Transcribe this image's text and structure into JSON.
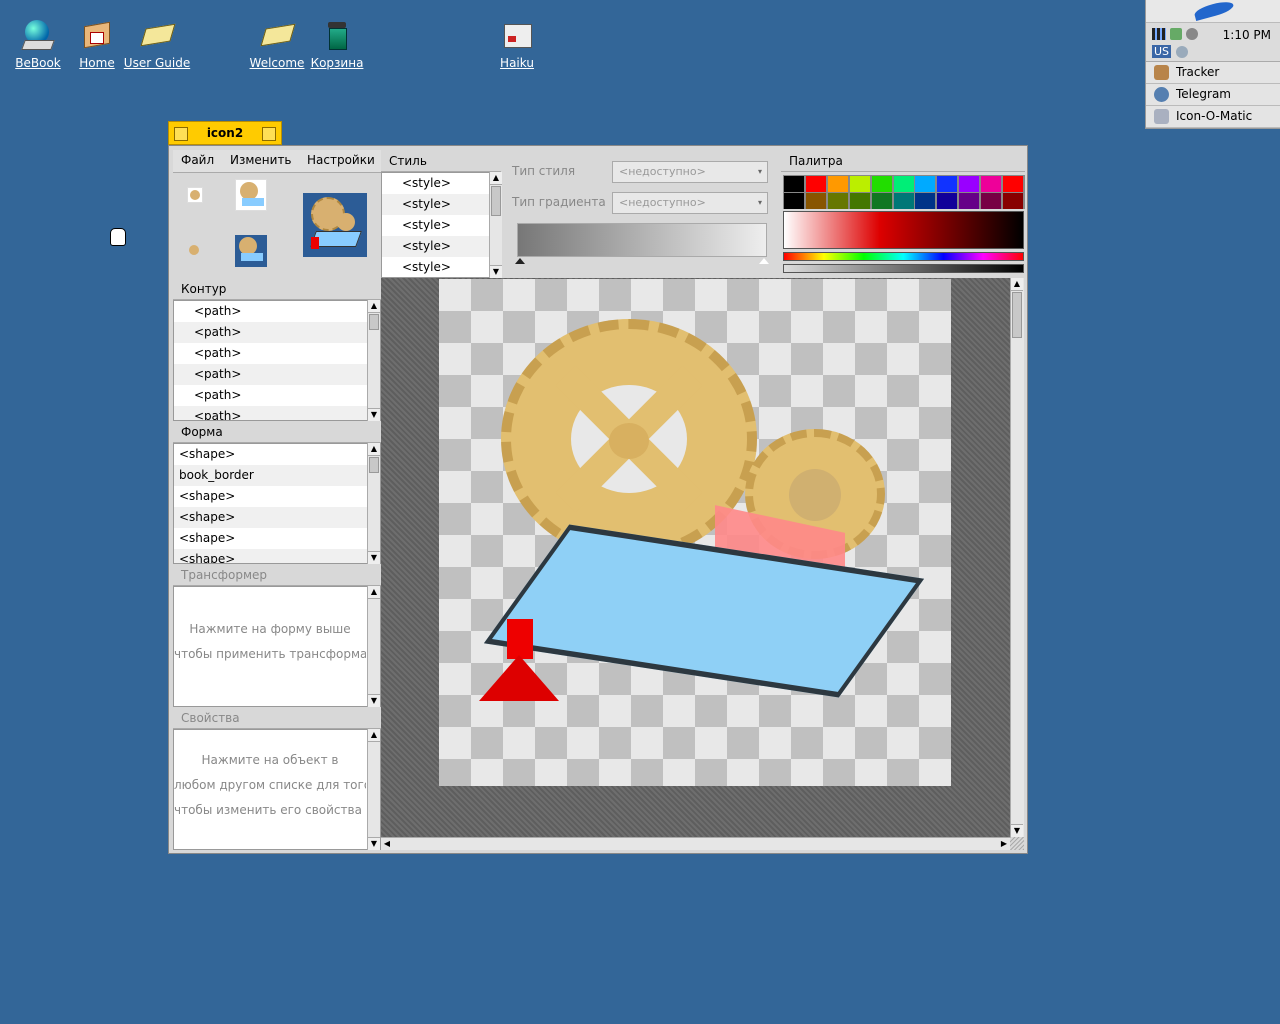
{
  "desktop": {
    "icons": [
      {
        "label": "BeBook",
        "icon": "globe-book-icon"
      },
      {
        "label": "Home",
        "icon": "home-folder-icon"
      },
      {
        "label": "User Guide",
        "icon": "user-guide-icon"
      },
      {
        "label": "Welcome",
        "icon": "welcome-icon"
      },
      {
        "label": "Корзина",
        "icon": "trash-icon"
      },
      {
        "label": "Haiku",
        "icon": "haiku-disk-icon"
      }
    ]
  },
  "deskbar": {
    "time": "1:10 PM",
    "keyboard_layout": "US",
    "apps": [
      {
        "label": "Tracker",
        "icon": "tracker-icon"
      },
      {
        "label": "Telegram",
        "icon": "telegram-icon"
      },
      {
        "label": "Icon-O-Matic",
        "icon": "icon-o-matic-icon"
      }
    ]
  },
  "window": {
    "title": "icon2",
    "menu": {
      "file": "Файл",
      "edit": "Изменить",
      "settings": "Настройки"
    },
    "style_header": "Стиль",
    "styles": [
      "<style>",
      "<style>",
      "<style>",
      "<style>",
      "<style>"
    ],
    "style_type_label": "Тип стиля",
    "style_type_value": "<недоступно>",
    "gradient_type_label": "Тип градиента",
    "gradient_type_value": "<недоступно>",
    "palette_header": "Палитра",
    "path_header": "Контур",
    "paths": [
      "<path>",
      "<path>",
      "<path>",
      "<path>",
      "<path>",
      "<path>"
    ],
    "shape_header": "Форма",
    "shapes": [
      "<shape>",
      "book_border",
      "<shape>",
      "<shape>",
      "<shape>",
      "<shape>"
    ],
    "transformer_header": "Трансформер",
    "transformer_hint": [
      "Нажмите на форму выше",
      "чтобы применить трансформатор"
    ],
    "properties_header": "Свойства",
    "properties_hint": [
      "Нажмите на объект в",
      "любом другом списке для того,",
      "чтобы изменить его свойства здесь"
    ]
  },
  "colors": {
    "desktop": "#336698",
    "tab": "#ffcb00",
    "palette_row1": [
      "#000000",
      "#ff0000",
      "#ff9900",
      "#bbee00",
      "#22dd00",
      "#00ee77",
      "#00aaff",
      "#1133ff",
      "#9900ff",
      "#ee0099",
      "#ff0000"
    ],
    "palette_row2": [
      "#000000",
      "#885500",
      "#667700",
      "#447700",
      "#117722",
      "#007777",
      "#003388",
      "#110099",
      "#660088",
      "#770044",
      "#880000"
    ]
  }
}
